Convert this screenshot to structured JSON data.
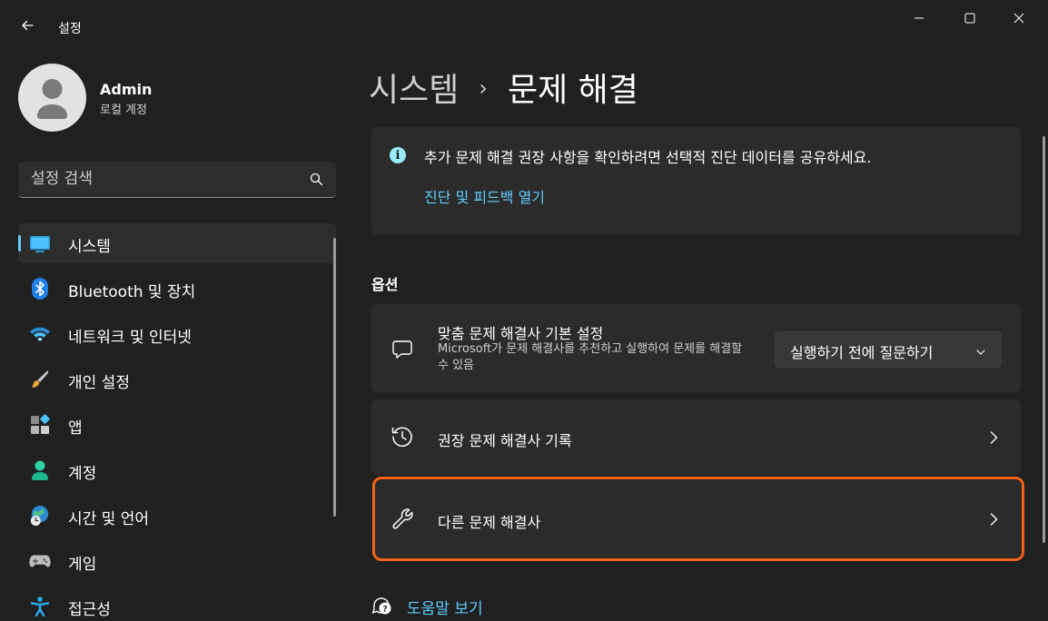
{
  "window": {
    "title": "설정"
  },
  "profile": {
    "name": "Admin",
    "account_type": "로컬 계정"
  },
  "search": {
    "placeholder": "설정 검색"
  },
  "sidebar": {
    "items": [
      {
        "label": "시스템",
        "icon": "system-monitor-icon",
        "active": true
      },
      {
        "label": "Bluetooth 및 장치",
        "icon": "bluetooth-icon"
      },
      {
        "label": "네트워크 및 인터넷",
        "icon": "wifi-icon"
      },
      {
        "label": "개인 설정",
        "icon": "paintbrush-icon"
      },
      {
        "label": "앱",
        "icon": "apps-icon"
      },
      {
        "label": "계정",
        "icon": "account-icon"
      },
      {
        "label": "시간 및 언어",
        "icon": "globe-clock-icon"
      },
      {
        "label": "게임",
        "icon": "gamepad-icon"
      },
      {
        "label": "접근성",
        "icon": "accessibility-icon"
      }
    ]
  },
  "breadcrumb": {
    "parent": "시스템",
    "separator": "›",
    "current": "문제 해결"
  },
  "info_banner": {
    "text": "추가 문제 해결 권장 사항을 확인하려면 선택적 진단 데이터를 공유하세요.",
    "link": "진단 및 피드백 열기"
  },
  "options": {
    "heading": "옵션",
    "preferences": {
      "title": "맞춤 문제 해결사 기본 설정",
      "description": "Microsoft가 문제 해결사를 추천하고 실행하여 문제를 해결할 수 있음",
      "dropdown_value": "실행하기 전에 질문하기"
    },
    "history": {
      "title": "권장 문제 해결사 기록"
    },
    "other": {
      "title": "다른 문제 해결사"
    }
  },
  "help": {
    "label": "도움말 보기"
  },
  "colors": {
    "background": "#202020",
    "card": "#2b2b2b",
    "accent": "#60cdff",
    "highlight": "#f26419"
  }
}
